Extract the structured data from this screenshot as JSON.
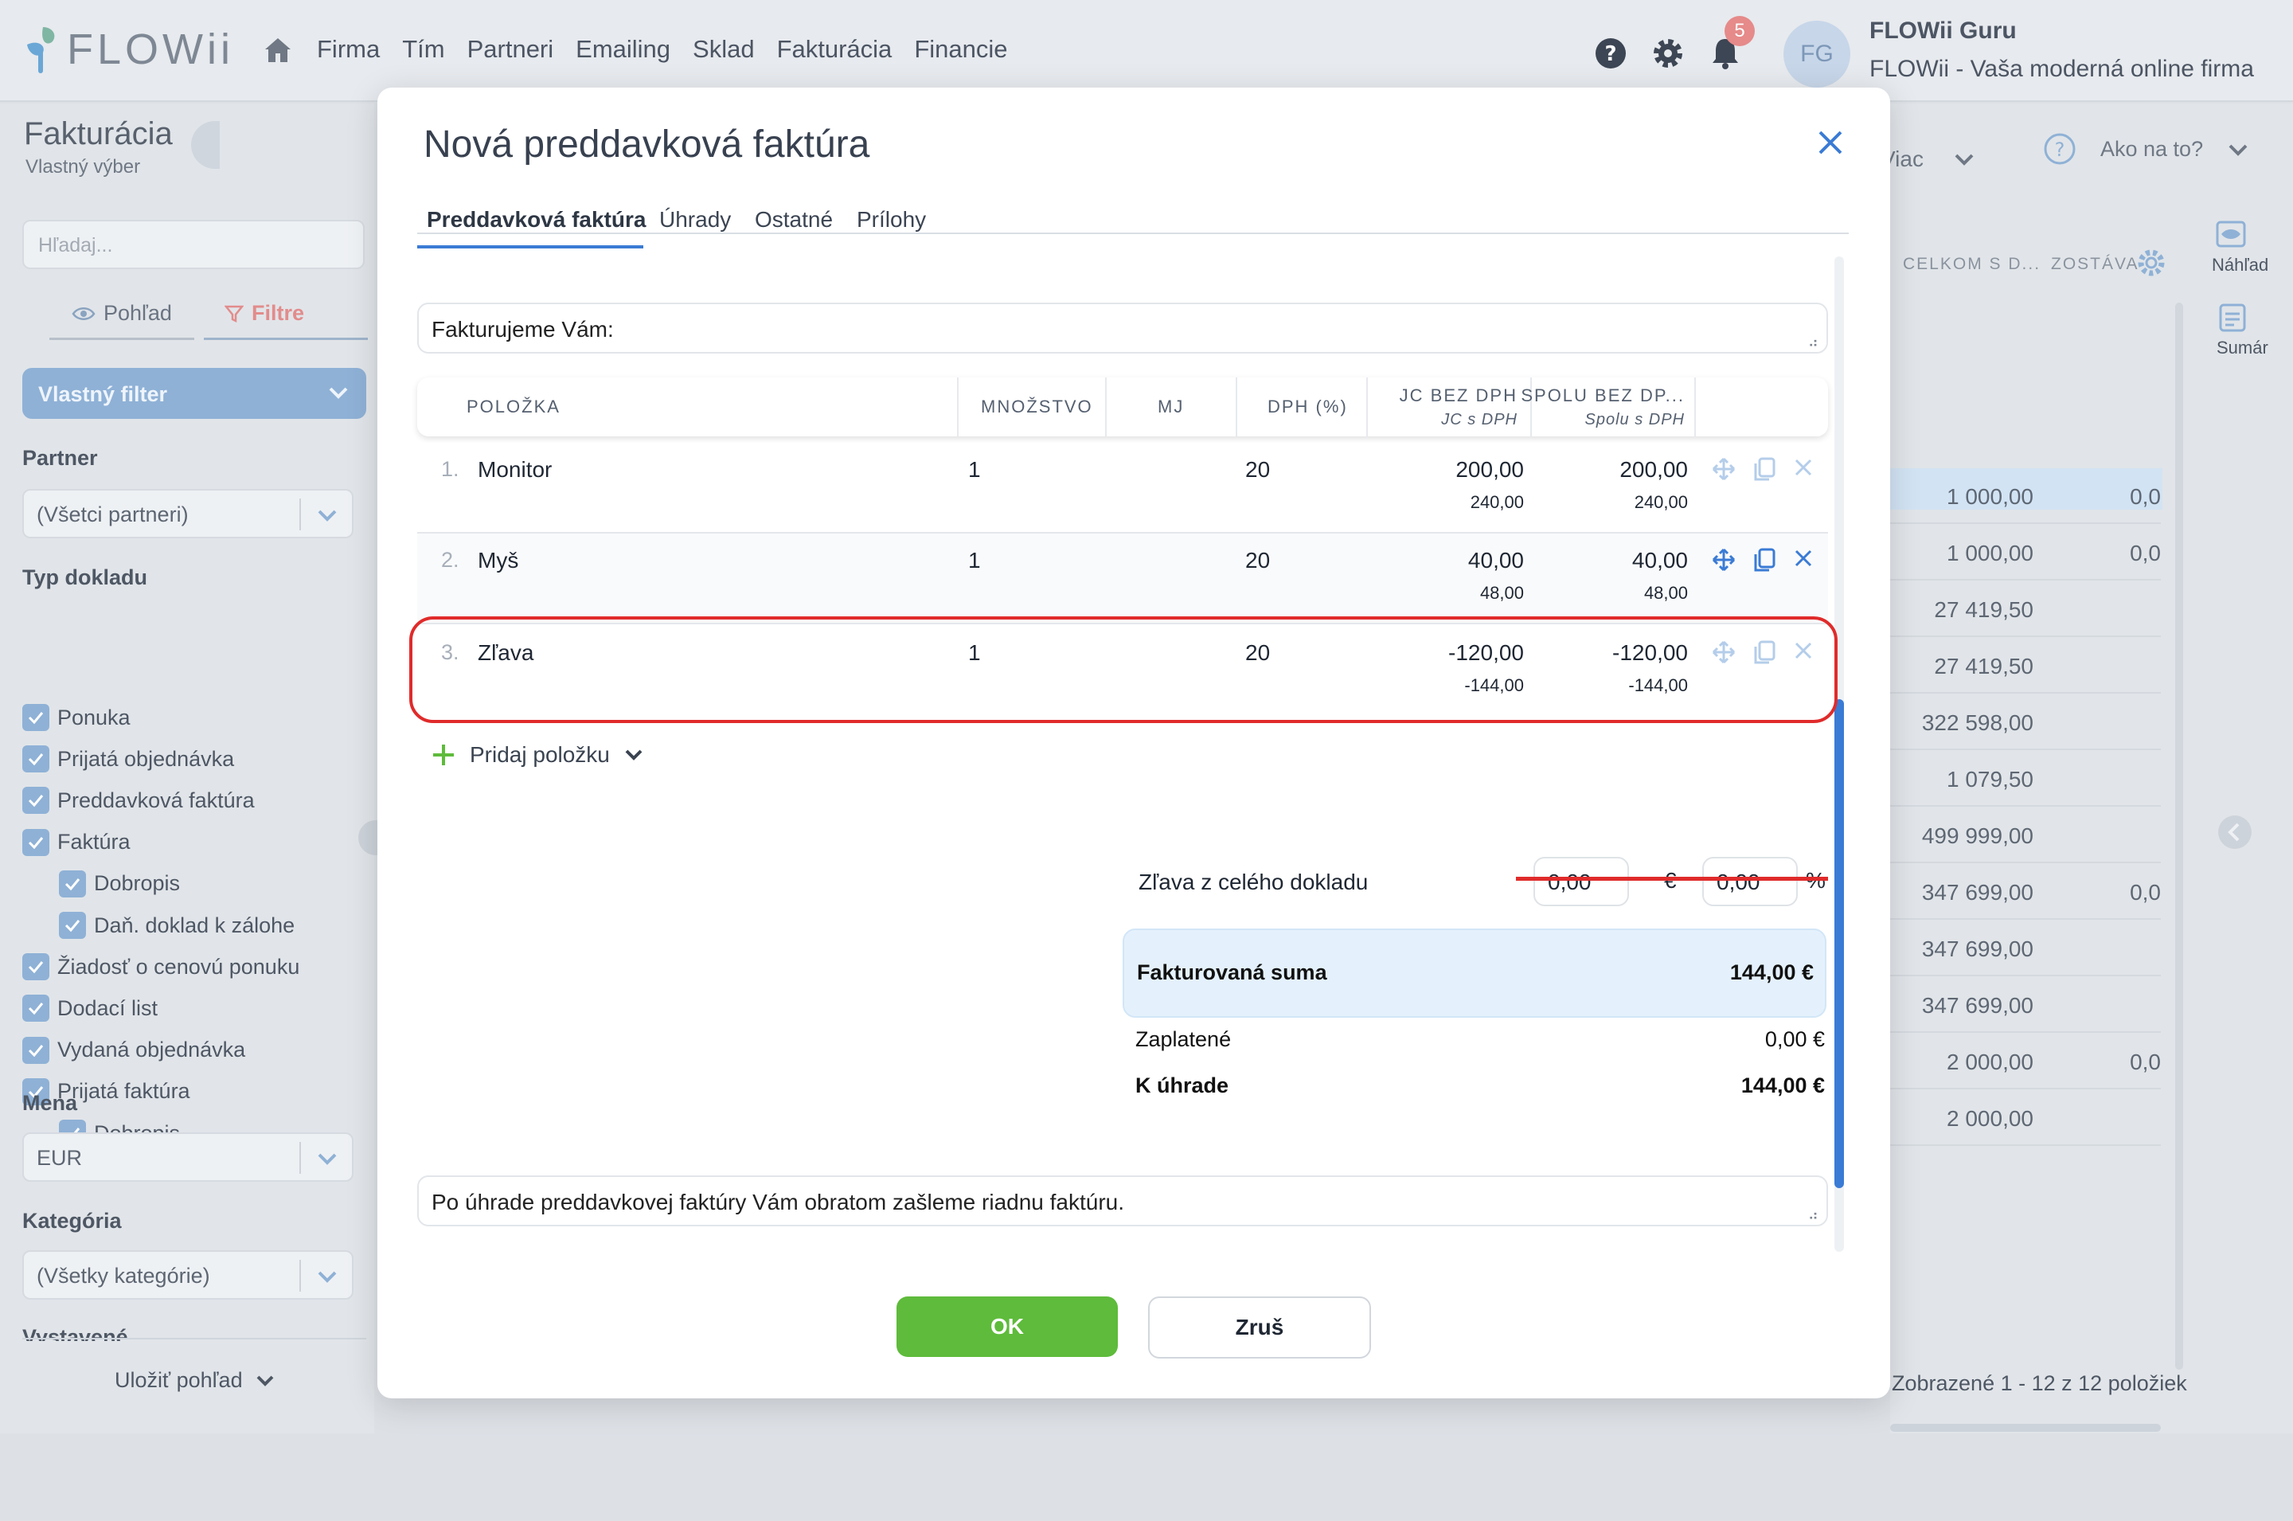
{
  "topbar": {
    "logo_text": "FLOWii",
    "nav": [
      "Firma",
      "Tím",
      "Partneri",
      "Emailing",
      "Sklad",
      "Fakturácia",
      "Financie"
    ],
    "notifications_count": "5",
    "avatar_initials": "FG",
    "user_name": "FLOWii Guru",
    "company": "FLOWii - Vaša moderná online firma"
  },
  "sidebar": {
    "title": "Fakturácia",
    "subtitle": "Vlastný výber",
    "search_placeholder": "Hľadaj...",
    "tab_view": "Pohľad",
    "tab_filters": "Filtre",
    "filter_select": "Vlastný filter",
    "partner_label": "Partner",
    "partner_value": "(Všetci partneri)",
    "doc_type_label": "Typ dokladu",
    "doc_types": [
      {
        "label": "Ponuka",
        "indent": false
      },
      {
        "label": "Prijatá objednávka",
        "indent": false
      },
      {
        "label": "Preddavková faktúra",
        "indent": false
      },
      {
        "label": "Faktúra",
        "indent": false
      },
      {
        "label": "Dobropis",
        "indent": true
      },
      {
        "label": "Daň. doklad k zálohe",
        "indent": true
      },
      {
        "label": "Žiadosť o cenovú ponuku",
        "indent": false
      },
      {
        "label": "Dodací list",
        "indent": false
      },
      {
        "label": "Vydaná objednávka",
        "indent": false
      },
      {
        "label": "Prijatá faktúra",
        "indent": false
      },
      {
        "label": "Dobropis",
        "indent": true
      }
    ],
    "currency_label": "Mena",
    "currency_value": "EUR",
    "category_label": "Kategória",
    "category_value": "(Všetky kategórie)",
    "cut_label": "Vystavené",
    "save_view": "Uložiť pohľad"
  },
  "background": {
    "more": "Viac",
    "help": "Ako na to?",
    "preview": "Náhľad",
    "summary": "Sumár",
    "col_total": "CELKOM S D...",
    "col_remaining": "ZOSTÁVA",
    "values": [
      {
        "total": "1 000,00",
        "rem": "0,0"
      },
      {
        "total": "1 000,00",
        "rem": "0,0"
      },
      {
        "total": "27 419,50",
        "rem": ""
      },
      {
        "total": "27 419,50",
        "rem": ""
      },
      {
        "total": "322 598,00",
        "rem": ""
      },
      {
        "total": "1 079,50",
        "rem": ""
      },
      {
        "total": "499 999,00",
        "rem": ""
      },
      {
        "total": "347 699,00",
        "rem": "0,0"
      },
      {
        "total": "347 699,00",
        "rem": ""
      },
      {
        "total": "347 699,00",
        "rem": ""
      },
      {
        "total": "2 000,00",
        "rem": "0,0"
      },
      {
        "total": "2 000,00",
        "rem": ""
      }
    ],
    "footer": "Zobrazené 1 - 12 z 12 položiek"
  },
  "modal": {
    "title": "Nová preddavková faktúra",
    "tabs": [
      "Preddavková faktúra",
      "Úhrady",
      "Ostatné",
      "Prílohy"
    ],
    "intro_text": "Fakturujeme Vám:",
    "columns": {
      "item": "POLOŽKA",
      "qty": "MNOŽSTVO",
      "unit": "MJ",
      "vat": "DPH (%)",
      "jc": "JC BEZ DPH",
      "jc_sub": "JC s DPH",
      "total": "SPOLU BEZ DP...",
      "total_sub": "Spolu s DPH"
    },
    "rows": [
      {
        "num": "1.",
        "name": "Monitor",
        "qty": "1",
        "vat": "20",
        "jc": "200,00",
        "jc_vat": "240,00",
        "total": "200,00",
        "total_vat": "240,00"
      },
      {
        "num": "2.",
        "name": "Myš",
        "qty": "1",
        "vat": "20",
        "jc": "40,00",
        "jc_vat": "48,00",
        "total": "40,00",
        "total_vat": "48,00"
      },
      {
        "num": "3.",
        "name": "Zľava",
        "qty": "1",
        "vat": "20",
        "jc": "-120,00",
        "jc_vat": "-144,00",
        "total": "-120,00",
        "total_vat": "-144,00"
      }
    ],
    "add_item": "Pridaj položku",
    "discount_label": "Zľava z celého dokladu",
    "discount_amount": "0,00",
    "discount_currency": "€",
    "discount_percent": "0,00",
    "percent_sign": "%",
    "invoiced_label": "Fakturovaná suma",
    "invoiced_value": "144,00 €",
    "paid_label": "Zaplatené",
    "paid_value": "0,00 €",
    "due_label": "K úhrade",
    "due_value": "144,00 €",
    "footer_text": "Po úhrade preddavkovej faktúry Vám obratom zašleme riadnu faktúru.",
    "ok": "OK",
    "cancel": "Zruš"
  },
  "colors": {
    "accent": "#3a7bd5",
    "ok": "#5ebb3b",
    "highlight": "#e02b2b"
  }
}
